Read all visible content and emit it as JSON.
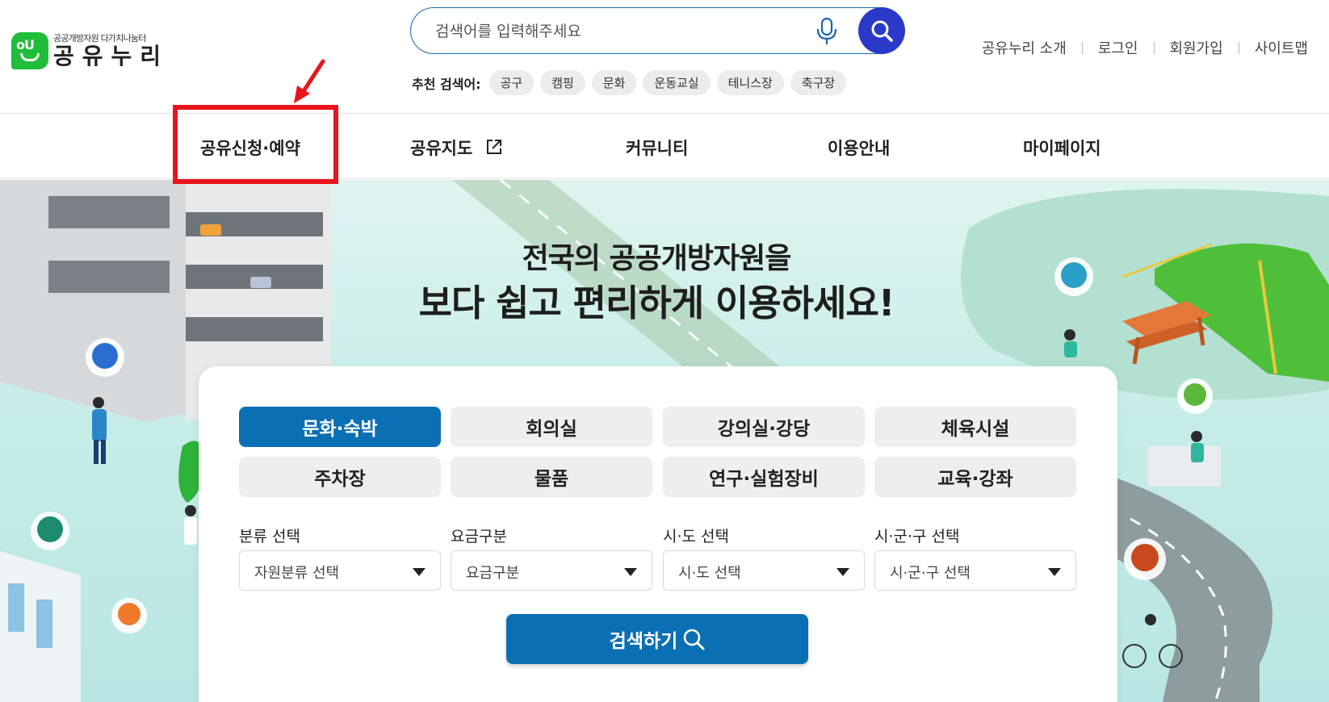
{
  "header": {
    "logo_sub": "공공개방자원 다가치나눔터",
    "logo_main": "공유누리",
    "logo_badge_text": "oU",
    "search_placeholder": "검색어를 입력해주세요",
    "recommend_label": "추천 검색어:",
    "recommend_tags": [
      "공구",
      "캠핑",
      "문화",
      "운동교실",
      "테니스장",
      "축구장"
    ],
    "utility_links": [
      "공유누리 소개",
      "로그인",
      "회원가입",
      "사이트맵"
    ]
  },
  "nav": {
    "items": [
      "공유신청·예약",
      "공유지도",
      "커뮤니티",
      "이용안내",
      "마이페이지"
    ]
  },
  "hero": {
    "title_line1": "전국의 공공개방자원을",
    "title_line2": "보다 쉽고 편리하게 이용하세요!"
  },
  "panel": {
    "categories": [
      "문화·숙박",
      "회의실",
      "강의실·강당",
      "체육시설",
      "주차장",
      "물품",
      "연구·실험장비",
      "교육·강좌"
    ],
    "active_category": "문화·숙박",
    "filters": [
      {
        "label": "분류 선택",
        "value": "자원분류 선택"
      },
      {
        "label": "요금구분",
        "value": "요금구분"
      },
      {
        "label": "시·도 선택",
        "value": "시·도 선택"
      },
      {
        "label": "시·군·구 선택",
        "value": "시·군·구 선택"
      }
    ],
    "search_button": "검색하기"
  },
  "colors": {
    "brand_green": "#1fbd3a",
    "primary_blue": "#0b6fb3",
    "search_button_blue": "#2b39c9",
    "highlight_red": "#e8141b"
  },
  "icons": [
    "microphone-icon",
    "search-icon",
    "external-link-icon",
    "dropdown-caret-icon",
    "red-arrow-icon"
  ]
}
